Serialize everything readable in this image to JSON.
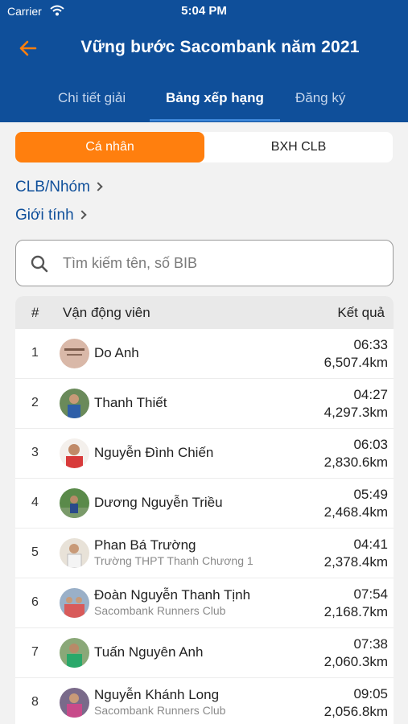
{
  "status_bar": {
    "carrier": "Carrier",
    "time": "5:04 PM"
  },
  "nav": {
    "title": "Vững bước Sacombank năm 2021"
  },
  "tabs": [
    {
      "label": "Chi tiết giải",
      "active": false
    },
    {
      "label": "Bảng xếp hạng",
      "active": true
    },
    {
      "label": "Đăng ký",
      "active": false
    }
  ],
  "segments": [
    {
      "label": "Cá nhân",
      "active": true
    },
    {
      "label": "BXH CLB",
      "active": false
    }
  ],
  "filters": {
    "club_label": "CLB/Nhóm",
    "gender_label": "Giới tính"
  },
  "search": {
    "placeholder": "Tìm kiếm tên, số BIB",
    "value": ""
  },
  "table": {
    "headers": {
      "rank": "#",
      "athlete": "Vận động viên",
      "result": "Kết quả"
    },
    "rows": [
      {
        "rank": "1",
        "name": "Do Anh",
        "sub": "",
        "time": "06:33",
        "distance": "6,507.4km"
      },
      {
        "rank": "2",
        "name": "Thanh Thiết",
        "sub": "",
        "time": "04:27",
        "distance": "4,297.3km"
      },
      {
        "rank": "3",
        "name": "Nguyễn Đình Chiến",
        "sub": "",
        "time": "06:03",
        "distance": "2,830.6km"
      },
      {
        "rank": "4",
        "name": "Dương Nguyễn Triều",
        "sub": "",
        "time": "05:49",
        "distance": "2,468.4km"
      },
      {
        "rank": "5",
        "name": "Phan Bá Trường",
        "sub": "Trường THPT Thanh Chương 1",
        "time": "04:41",
        "distance": "2,378.4km"
      },
      {
        "rank": "6",
        "name": "Đoàn Nguyễn Thanh Tịnh",
        "sub": "Sacombank Runners Club",
        "time": "07:54",
        "distance": "2,168.7km"
      },
      {
        "rank": "7",
        "name": "Tuấn Nguyên Anh",
        "sub": "",
        "time": "07:38",
        "distance": "2,060.3km"
      },
      {
        "rank": "8",
        "name": "Nguyễn Khánh Long",
        "sub": "Sacombank Runners Club",
        "time": "09:05",
        "distance": "2,056.8km"
      }
    ]
  },
  "colors": {
    "header_bg": "#0f4f9a",
    "accent": "#ff7f0e",
    "tab_underline": "#3d86d8"
  }
}
